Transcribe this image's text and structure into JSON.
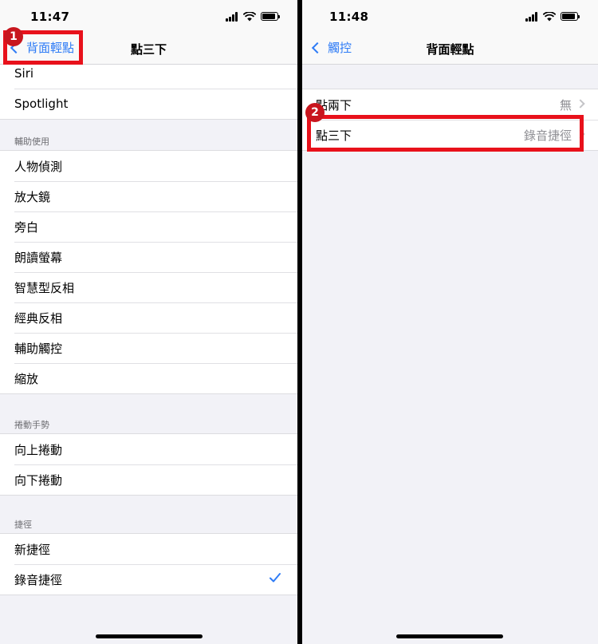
{
  "left": {
    "time": "11:47",
    "back_label": "背面輕點",
    "title": "點三下",
    "annotation": "1",
    "top_group": [
      "Siri",
      "Spotlight"
    ],
    "accessibility": {
      "header": "輔助使用",
      "items": [
        "人物偵測",
        "放大鏡",
        "旁白",
        "朗讀螢幕",
        "智慧型反相",
        "經典反相",
        "輔助觸控",
        "縮放"
      ]
    },
    "scroll_gestures": {
      "header": "捲動手勢",
      "items": [
        "向上捲動",
        "向下捲動"
      ]
    },
    "shortcuts": {
      "header": "捷徑",
      "items": [
        {
          "label": "新捷徑",
          "checked": false
        },
        {
          "label": "錄音捷徑",
          "checked": true
        }
      ]
    }
  },
  "right": {
    "time": "11:48",
    "back_label": "觸控",
    "title": "背面輕點",
    "annotation": "2",
    "rows": [
      {
        "label": "點兩下",
        "value": "無"
      },
      {
        "label": "點三下",
        "value": "錄音捷徑"
      }
    ]
  },
  "colors": {
    "accent": "#2f7cf6",
    "highlight": "#e8111b",
    "background": "#f2f2f7"
  }
}
